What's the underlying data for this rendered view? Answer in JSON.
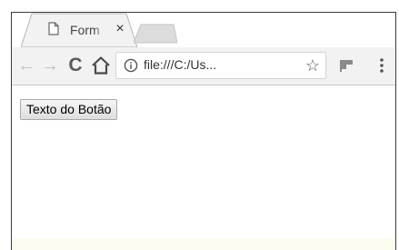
{
  "tab": {
    "title": "Form",
    "close_glyph": "×",
    "icon": "document-icon"
  },
  "toolbar": {
    "back_glyph": "←",
    "forward_glyph": "→",
    "reload_glyph": "C",
    "home_icon": "home-icon",
    "url": "file:///C:/Us...",
    "info_icon": "info-icon",
    "star_glyph": "☆",
    "extension_icon": "extension-flag-icon",
    "menu_icon": "menu-kebab-icon"
  },
  "page": {
    "button_label": "Texto do Botão"
  },
  "colors": {
    "toolbar_bg": "#f2f2f2",
    "tab_bg": "#f2f2f2",
    "inactive_tab": "#d9d9d9",
    "page_bg": "#ffffff"
  }
}
